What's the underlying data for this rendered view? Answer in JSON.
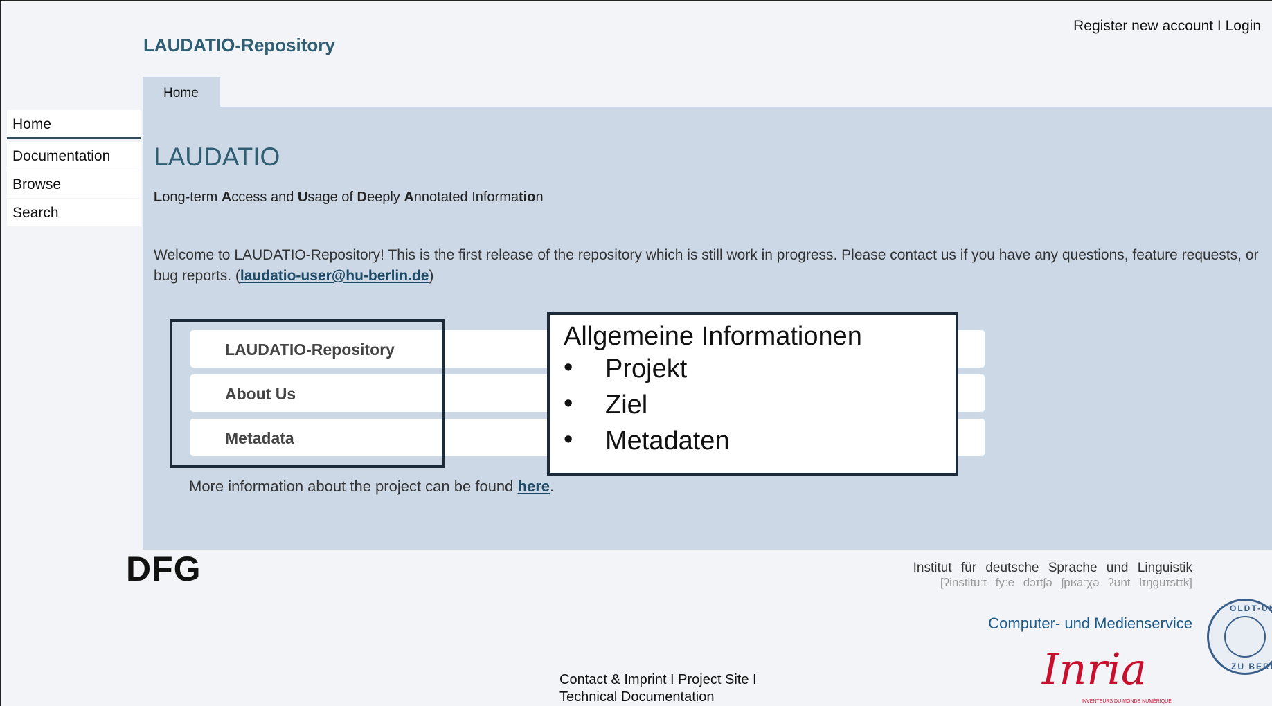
{
  "header": {
    "site_title": "LAUDATIO-Repository",
    "register_link": "Register new account",
    "separator": " I ",
    "login_link": "Login"
  },
  "tabs": [
    {
      "label": "Home"
    }
  ],
  "sidebar": {
    "items": [
      {
        "label": "Home"
      },
      {
        "label": "Documentation"
      },
      {
        "label": "Browse"
      },
      {
        "label": "Search"
      }
    ]
  },
  "main": {
    "heading": "LAUDATIO",
    "subtitle_parts": [
      "L",
      "ong-term ",
      "A",
      "ccess and ",
      "U",
      "sage of ",
      "D",
      "eeply ",
      "A",
      "nnotated Informa",
      "tio",
      "n"
    ],
    "welcome_text": "Welcome to LAUDATIO-Repository! This is the first release of the repository which is still work in progress. Please contact us if you have any questions, feature requests, or bug reports. (",
    "welcome_email": "laudatio-user@hu-berlin.de",
    "welcome_close": ")",
    "accordion": [
      {
        "label": "LAUDATIO-Repository"
      },
      {
        "label": "About Us"
      },
      {
        "label": "Metadata"
      }
    ],
    "more_text": "More information about the project can be found ",
    "more_link": "here",
    "more_end": "."
  },
  "callout": {
    "title": "Allgemeine Informationen",
    "items": [
      "Projekt",
      "Ziel",
      "Metadaten"
    ]
  },
  "logos": {
    "dfg": "DFG",
    "ids_line1": "Institut für deutsche Sprache und Linguistik",
    "ids_line2": "[ʔinstituːt fyːe dɔɪtʃə ʃpʁaːχə ʔʊnt lɪŋguɪstɪk]",
    "cms": "Computer- und Medienservice",
    "hu_seal_top": "OLDT-UNI",
    "hu_seal_bottom": "ZU BERL",
    "inria": "Inria",
    "inria_tagline": "INVENTEURS DU MONDE NUMÉRIQUE"
  },
  "footer": {
    "line1": "Contact & Imprint I Project Site I",
    "line2": "Technical Documentation"
  }
}
